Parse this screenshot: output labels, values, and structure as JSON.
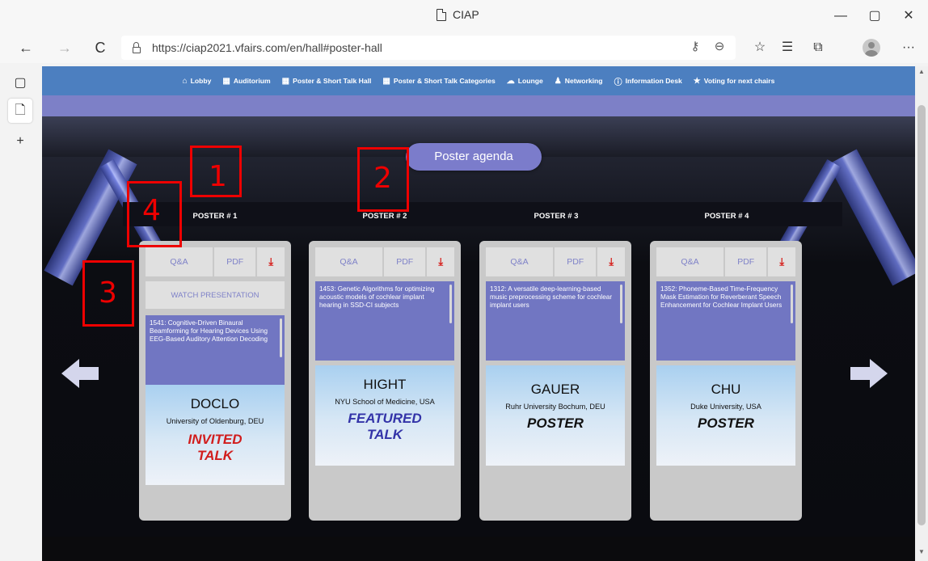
{
  "window": {
    "title": "CIAP",
    "controls": [
      "—",
      "▢",
      "✕"
    ]
  },
  "browser": {
    "url": "https://ciap2021.vfairs.com/en/hall#poster-hall",
    "back_icon": "←",
    "forward_icon": "→",
    "refresh_icon": "C",
    "more_icon": "···"
  },
  "sidebar": {
    "items": [
      "▢",
      "🗋",
      "+"
    ]
  },
  "site_nav": {
    "items": [
      {
        "icon": "⌂",
        "label": "Lobby"
      },
      {
        "icon": "▦",
        "label": "Auditorium"
      },
      {
        "icon": "▦",
        "label": "Poster & Short Talk Hall"
      },
      {
        "icon": "▦",
        "label": "Poster & Short Talk Categories"
      },
      {
        "icon": "☁",
        "label": "Lounge"
      },
      {
        "icon": "♟",
        "label": "Networking"
      },
      {
        "icon": "ⓘ",
        "label": "Information Desk"
      },
      {
        "icon": "★",
        "label": "Voting for next chairs"
      }
    ],
    "color": "#4c7fc0"
  },
  "hall": {
    "agenda_button": "Poster agenda",
    "posters": [
      {
        "label": "POSTER # 1",
        "qa": "Q&A",
        "pdf": "PDF",
        "watch": "WATCH PRESENTATION",
        "abstract": "1541: Cognitive-Driven Binaural Beamforming for Hearing Devices Using EEG-Based Auditory Attention Decoding",
        "author": "DOCLO",
        "affiliation": "University of Oldenburg, DEU",
        "type_line1": "INVITED",
        "type_line2": "TALK"
      },
      {
        "label": "POSTER # 2",
        "qa": "Q&A",
        "pdf": "PDF",
        "abstract": "1453: Genetic Algorithms for optimizing acoustic models of cochlear implant hearing in SSD-CI subjects",
        "author": "HIGHT",
        "affiliation": "NYU School of Medicine, USA",
        "type_line1": "FEATURED",
        "type_line2": "TALK"
      },
      {
        "label": "POSTER # 3",
        "qa": "Q&A",
        "pdf": "PDF",
        "abstract": "1312: A versatile deep-learning-based music preprocessing scheme for cochlear implant users",
        "author": "GAUER",
        "affiliation": "Ruhr University Bochum, DEU",
        "type_line1": "POSTER",
        "type_line2": ""
      },
      {
        "label": "POSTER # 4",
        "qa": "Q&A",
        "pdf": "PDF",
        "abstract": "1352: Phoneme-Based Time-Frequency Mask Estimation for Reverberant Speech Enhancement for Cochlear Implant Users",
        "author": "CHU",
        "affiliation": "Duke University, USA",
        "type_line1": "POSTER",
        "type_line2": ""
      }
    ]
  },
  "annotations": [
    "1",
    "2",
    "3",
    "4"
  ]
}
